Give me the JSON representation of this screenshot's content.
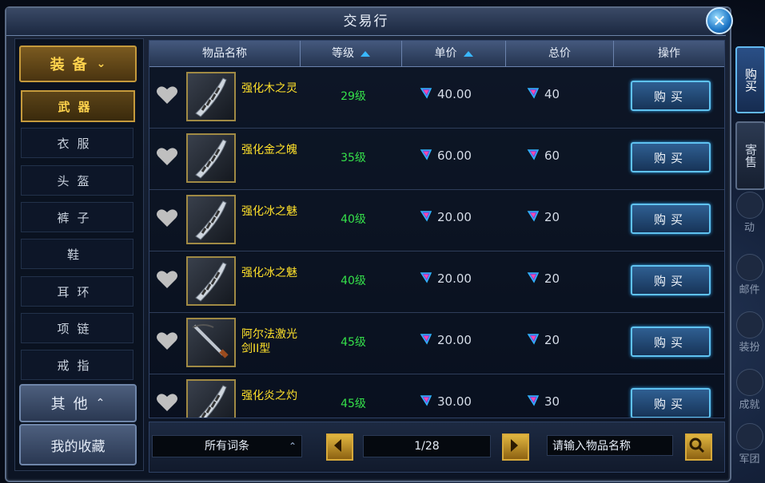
{
  "window": {
    "title": "交易行",
    "close_label": "✕"
  },
  "category": {
    "head": "装备",
    "items": [
      "武器",
      "衣服",
      "头盔",
      "裤子",
      "鞋",
      "耳环",
      "项链",
      "戒指"
    ],
    "active_index": 0,
    "other_label": "其他",
    "favorites_label": "我的收藏"
  },
  "table": {
    "headers": {
      "name": "物品名称",
      "level": "等级",
      "unit_price": "单价",
      "total_price": "总价",
      "action": "操作"
    },
    "rows": [
      {
        "name": "强化木之灵",
        "level": "29级",
        "unit_price": "40.00",
        "total_price": "40",
        "buy": "购买"
      },
      {
        "name": "强化金之魄",
        "level": "35级",
        "unit_price": "60.00",
        "total_price": "60",
        "buy": "购买"
      },
      {
        "name": "强化冰之魅",
        "level": "40级",
        "unit_price": "20.00",
        "total_price": "20",
        "buy": "购买"
      },
      {
        "name": "强化冰之魅",
        "level": "40级",
        "unit_price": "20.00",
        "total_price": "20",
        "buy": "购买"
      },
      {
        "name": "阿尔法激光剑II型",
        "level": "45级",
        "unit_price": "20.00",
        "total_price": "20",
        "buy": "购买"
      },
      {
        "name": "强化炎之灼",
        "level": "45级",
        "unit_price": "30.00",
        "total_price": "30",
        "buy": "购买"
      }
    ]
  },
  "footer": {
    "filter": "所有词条",
    "page": "1/28",
    "search_placeholder": "请输入物品名称"
  },
  "right_tabs": {
    "buy": "购买",
    "consign": "寄售"
  },
  "side_buttons": [
    "动",
    "邮件",
    "装扮",
    "成就",
    "军团"
  ],
  "colors": {
    "accent_gold": "#ffd34d",
    "level_green": "#35e04a",
    "item_name_yellow": "#ffe12a",
    "button_blue": "#2f5f92"
  }
}
